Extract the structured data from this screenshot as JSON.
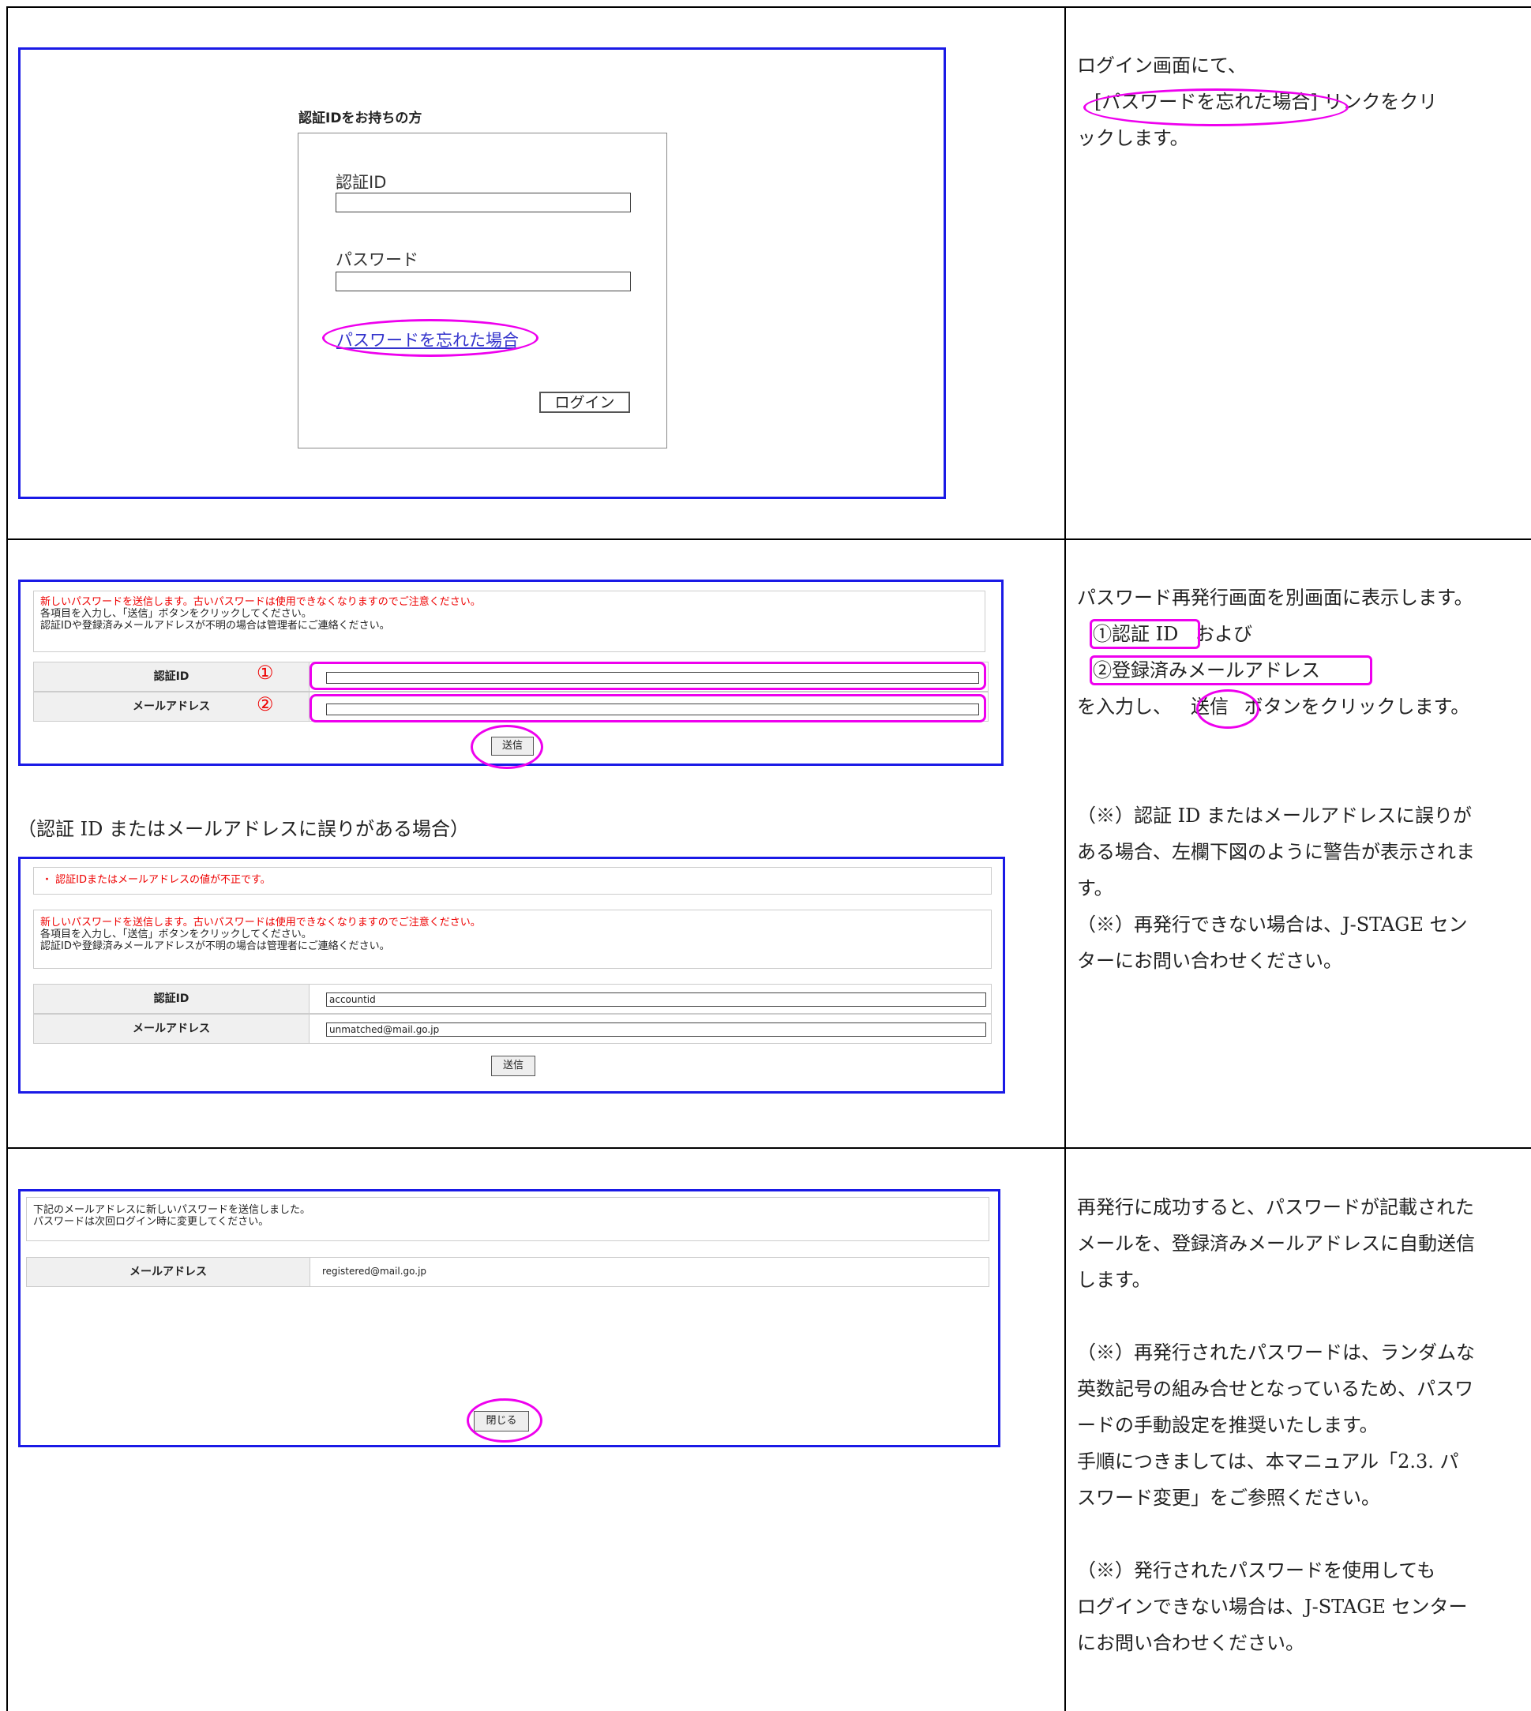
{
  "row1": {
    "login_panel": {
      "heading": "認証IDをお持ちの方",
      "id_label": "認証ID",
      "password_label": "パスワード",
      "forgot_link": "パスワードを忘れた場合",
      "login_button": "ログイン"
    },
    "explanation": {
      "line1": "ログイン画面にて、",
      "link_ref": "[パスワードを忘れた場合]",
      "line2_rest": " リンクをクリ",
      "line3": "ックします。"
    }
  },
  "row2": {
    "form": {
      "notice_red": "新しいパスワードを送信します。古いパスワードは使用できなくなりますのでご注意ください。",
      "notice_line2": "各項目を入力し、「送信」ボタンをクリックしてください。",
      "notice_line3": "認証IDや登録済みメールアドレスが不明の場合は管理者にご連絡ください。",
      "id_label": "認証ID",
      "mail_label": "メールアドレス",
      "marker1": "①",
      "marker2": "②",
      "submit": "送信"
    },
    "error_caption": "（認証 ID またはメールアドレスに誤りがある場合）",
    "error_form": {
      "error_msg": "・ 認証IDまたはメールアドレスの値が不正です。",
      "notice_red": "新しいパスワードを送信します。古いパスワードは使用できなくなりますのでご注意ください。",
      "notice_line2": "各項目を入力し、「送信」ボタンをクリックしてください。",
      "notice_line3": "認証IDや登録済みメールアドレスが不明の場合は管理者にご連絡ください。",
      "id_label": "認証ID",
      "mail_label": "メールアドレス",
      "id_value": "accountid",
      "mail_value": "unmatched@mail.go.jp",
      "submit": "送信"
    },
    "explanation": {
      "line1": "パスワード再発行画面を別画面に表示します。",
      "item1": "①認証 ID",
      "and": "  および",
      "item2": "②登録済みメールアドレス",
      "line4_pre": "を入力し、",
      "send": "送信",
      "line4_post": " ボタンをクリックします。",
      "note1a": "（※）認証 ID またはメールアドレスに誤りが",
      "note1b": "ある場合、左欄下図のように警告が表示されま",
      "note1c": "す。",
      "note2a": "（※）再発行できない場合は、J-STAGE セン",
      "note2b": "ターにお問い合わせください。"
    }
  },
  "row3": {
    "result": {
      "line1": "下記のメールアドレスに新しいパスワードを送信しました。",
      "line2": "パスワードは次回ログイン時に変更してください。",
      "mail_label": "メールアドレス",
      "mail_value": "registered@mail.go.jp",
      "close": "閉じる"
    },
    "explanation": {
      "p1a": "再発行に成功すると、パスワードが記載された",
      "p1b": "メールを、登録済みメールアドレスに自動送信",
      "p1c": "します。",
      "p2a": "（※）再発行されたパスワードは、ランダムな",
      "p2b": "英数記号の組み合せとなっているため、パスワ",
      "p2c": "ードの手動設定を推奨いたします。",
      "p2d": "手順につきましては、本マニュアル「2.3. パ",
      "p2e": "スワード変更」をご参照ください。",
      "p3a": "（※）発行されたパスワードを使用しても",
      "p3b": "ログインできない場合は、J-STAGE センター",
      "p3c": "にお問い合わせください。"
    }
  }
}
